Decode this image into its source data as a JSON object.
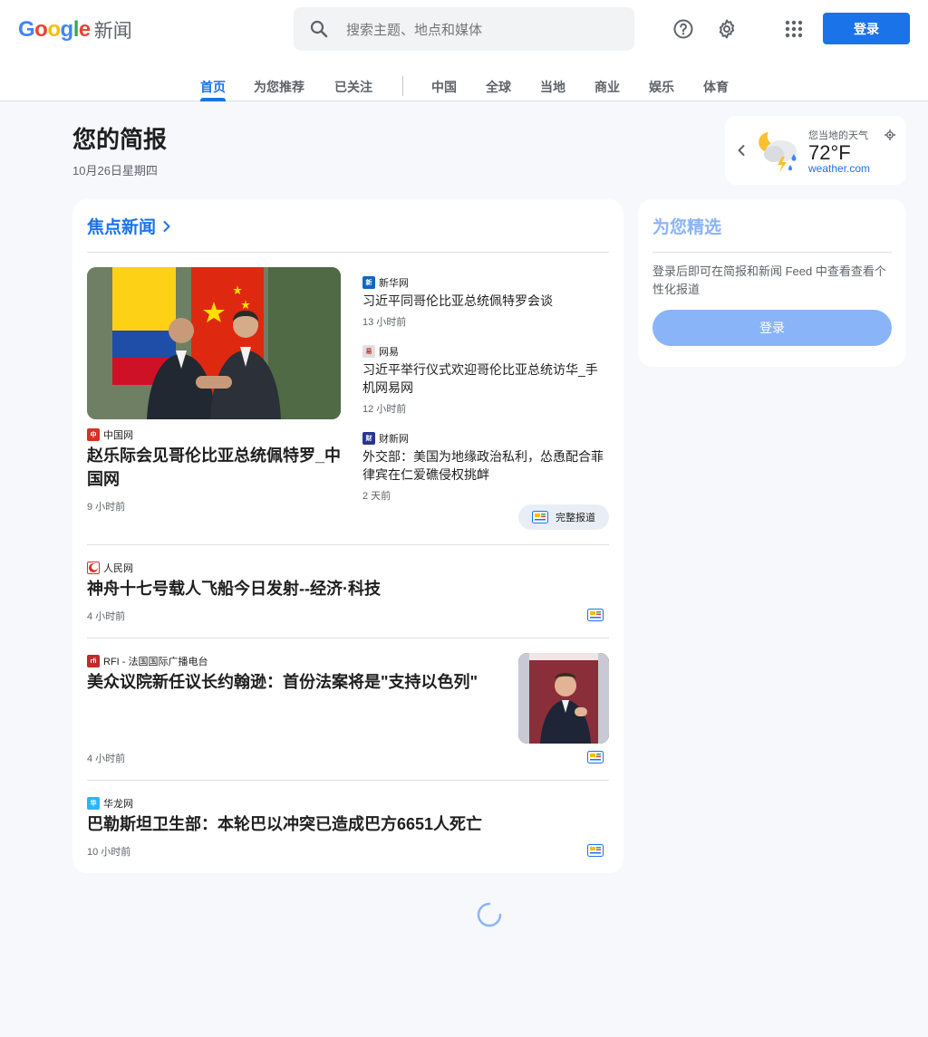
{
  "header": {
    "logo_letters": [
      "G",
      "o",
      "o",
      "g",
      "l",
      "e"
    ],
    "logo_colors": [
      "#4285f4",
      "#ea4335",
      "#fbbc05",
      "#4285f4",
      "#34a853",
      "#ea4335"
    ],
    "product_name": "新闻",
    "search_placeholder": "搜索主题、地点和媒体",
    "login_label": "登录",
    "icons": [
      "search-icon",
      "help-icon",
      "settings-icon",
      "apps-icon"
    ]
  },
  "tabs": [
    {
      "label": "首页",
      "active": true
    },
    {
      "label": "为您推荐"
    },
    {
      "label": "已关注"
    },
    {
      "label": "中国"
    },
    {
      "label": "全球"
    },
    {
      "label": "当地"
    },
    {
      "label": "商业"
    },
    {
      "label": "娱乐"
    },
    {
      "label": "体育"
    }
  ],
  "briefing": {
    "title": "您的简报",
    "date": "10月26日星期四"
  },
  "weather": {
    "label": "您当地的天气",
    "temp": "72°F",
    "source": "weather.com"
  },
  "top_stories": {
    "title": "焦点新闻",
    "lead": {
      "source": "中国网",
      "headline": "赵乐际会见哥伦比亚总统佩特罗_中国网",
      "time": "9 小时前"
    },
    "related": [
      {
        "source": "新华网",
        "headline": "习近平同哥伦比亚总统佩特罗会谈",
        "time": "13 小时前"
      },
      {
        "source": "网易",
        "headline": "习近平举行仪式欢迎哥伦比亚总统访华_手机网易网",
        "time": "12 小时前"
      },
      {
        "source": "财新网",
        "headline": "外交部：美国为地缘政治私利，怂恿配合菲律宾在仁爱礁侵权挑衅",
        "time": "2 天前"
      }
    ],
    "full_coverage_label": "完整报道",
    "stories": [
      {
        "source": "人民网",
        "headline": "神舟十七号载人飞船今日发射--经济·科技",
        "time": "4 小时前"
      },
      {
        "source": "RFI - 法国国际广播电台",
        "headline": "美众议院新任议长约翰逊：首份法案将是\"支持以色列\"",
        "time": "4 小时前"
      },
      {
        "source": "华龙网",
        "headline": "巴勒斯坦卫生部：本轮巴以冲突已造成巴方6651人死亡",
        "time": "10 小时前"
      }
    ]
  },
  "picks": {
    "title": "为您精选",
    "text": "登录后即可在简报和新闻 Feed 中查看查看个性化报道",
    "button": "登录"
  },
  "colors": {
    "accent": "#1a73e8",
    "accent_light": "#8ab4f8",
    "background": "#f6f8fc"
  }
}
